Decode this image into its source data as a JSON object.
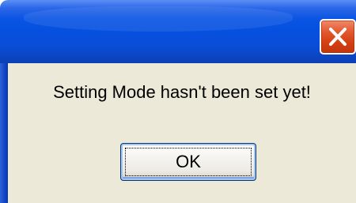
{
  "dialog": {
    "title": "",
    "message": "Setting Mode hasn't been set yet!",
    "ok_label": "OK",
    "close_icon": "close-icon"
  },
  "colors": {
    "titlebar": "#0a54e3",
    "close_button": "#d23f12",
    "client_background": "#ece9d8",
    "button_border": "#003c74"
  }
}
